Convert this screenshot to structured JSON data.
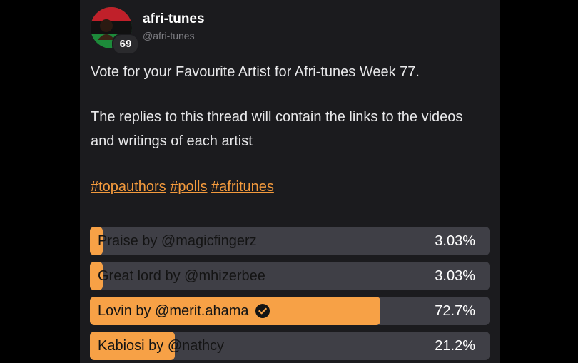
{
  "post": {
    "display_name": "afri-tunes",
    "handle": "@afri-tunes",
    "level_badge": "69",
    "line1": "Vote for your Favourite Artist for Afri-tunes Week 77.",
    "line2": "The replies to this thread will contain the links to the videos and writings of each artist",
    "tags": [
      "#topauthors",
      "#polls",
      "#afritunes"
    ]
  },
  "poll": {
    "options": [
      {
        "label": "Praise by @magicfingerz",
        "percent_text": "3.03%",
        "percent": 3.03,
        "voted": false
      },
      {
        "label": "Great lord by @mhizerbee",
        "percent_text": "3.03%",
        "percent": 3.03,
        "voted": false
      },
      {
        "label": "Lovin by @merit.ahama",
        "percent_text": "72.7%",
        "percent": 72.7,
        "voted": true
      },
      {
        "label": "Kabiosi by @nathcy",
        "percent_text": "21.2%",
        "percent": 21.2,
        "voted": false
      }
    ]
  },
  "colors": {
    "accent": "#f7a146",
    "tag": "#f39a3d",
    "bar_bg": "#3f3f46",
    "card_bg": "#1b1b1e"
  },
  "icons": {
    "voted_marker": "check-circle-icon"
  }
}
